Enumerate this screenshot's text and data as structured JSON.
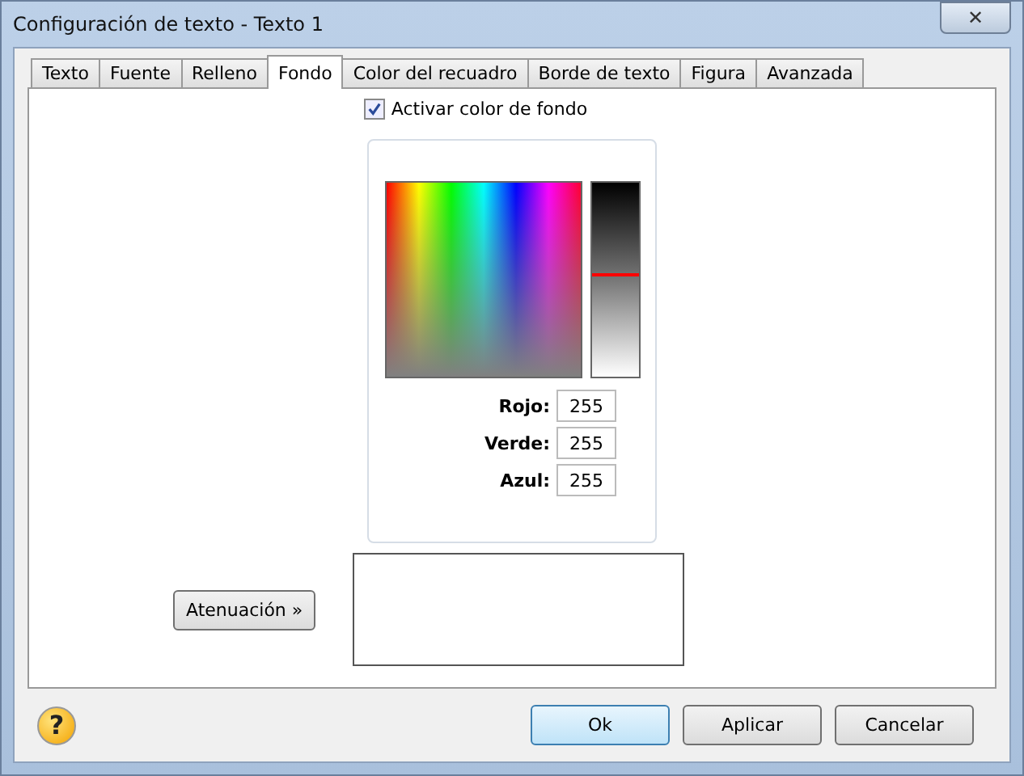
{
  "window": {
    "title": "Configuración de texto - Texto 1",
    "close_label": "✕"
  },
  "tabs": [
    {
      "label": "Texto",
      "selected": false
    },
    {
      "label": "Fuente",
      "selected": false
    },
    {
      "label": "Relleno",
      "selected": false
    },
    {
      "label": "Fondo",
      "selected": true
    },
    {
      "label": "Color del recuadro",
      "selected": false
    },
    {
      "label": "Borde de texto",
      "selected": false
    },
    {
      "label": "Figura",
      "selected": false
    },
    {
      "label": "Avanzada",
      "selected": false
    }
  ],
  "background_toggle": {
    "label": "Activar color de fondo",
    "checked": true
  },
  "brightness_slider": {
    "level": 0.53
  },
  "rgb_fields": [
    {
      "label": "Rojo:",
      "value": "255"
    },
    {
      "label": "Verde:",
      "value": "255"
    },
    {
      "label": "Azul:",
      "value": "255"
    }
  ],
  "fade_button": "Atenuación »",
  "help_label": "?",
  "buttons": [
    {
      "label": "Ok",
      "selected": true
    },
    {
      "label": "Aplicar",
      "selected": false
    },
    {
      "label": "Cancelar",
      "selected": false
    }
  ]
}
